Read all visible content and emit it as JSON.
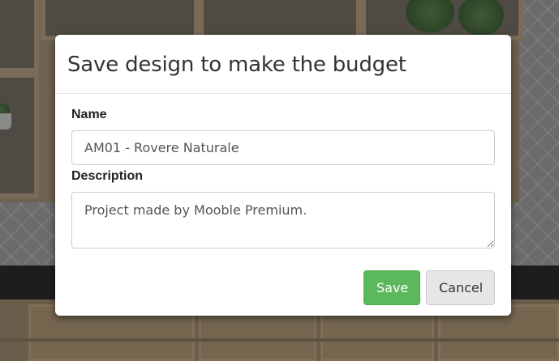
{
  "modal": {
    "title": "Save design to make the budget",
    "name_label": "Name",
    "name_value": "AM01 - Rovere Naturale",
    "description_label": "Description",
    "description_value": "Project made by Mooble Premium.",
    "save_label": "Save",
    "cancel_label": "Cancel"
  },
  "colors": {
    "save_button": "#5cb85c",
    "cancel_button": "#e6e6e6",
    "backdrop": "#6a6458"
  }
}
